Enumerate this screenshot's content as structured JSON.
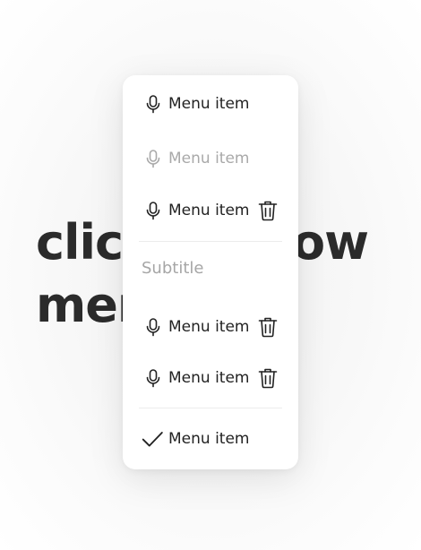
{
  "background": {
    "line1_left": "clic",
    "line1_right": "ow",
    "line2": "mer"
  },
  "menu": {
    "items_top": [
      {
        "label": "Menu item",
        "icon": "microphone-icon",
        "disabled": false,
        "trailing_icon": null
      },
      {
        "label": "Menu item",
        "icon": "microphone-icon",
        "disabled": true,
        "trailing_icon": null
      },
      {
        "label": "Menu item",
        "icon": "microphone-icon",
        "disabled": false,
        "trailing_icon": "trash-icon"
      }
    ],
    "subtitle": "Subtitle",
    "items_group": [
      {
        "label": "Menu item",
        "icon": "microphone-icon",
        "disabled": false,
        "trailing_icon": "trash-icon"
      },
      {
        "label": "Menu item",
        "icon": "microphone-icon",
        "disabled": false,
        "trailing_icon": "trash-icon"
      }
    ],
    "checked_item": {
      "label": "Menu item",
      "icon": "checkmark-icon",
      "checked": true
    }
  },
  "colors": {
    "text": "#222222",
    "disabled_text": "#a9a9a9",
    "subtitle_text": "#a6a6a6",
    "background_heading": "#2b2b2b"
  }
}
